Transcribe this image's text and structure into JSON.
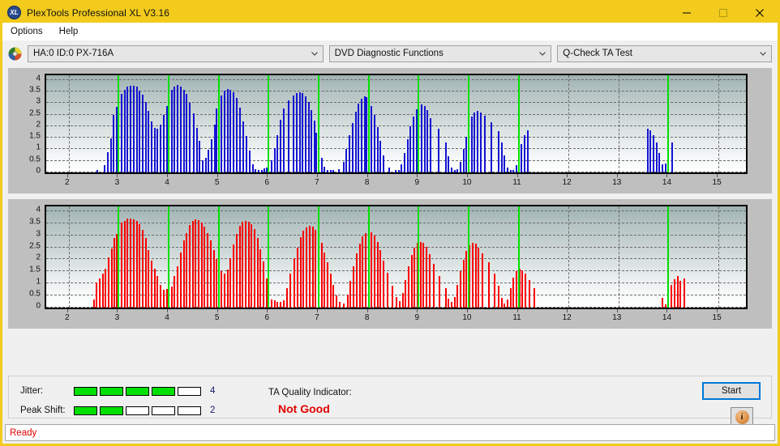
{
  "window": {
    "title": "PlexTools Professional XL V3.16",
    "app_icon": "xl-disc-icon",
    "minimize_label": "Minimize",
    "maximize_label": "Maximize",
    "close_label": "Close",
    "titlebar_color": "#f2cb1d"
  },
  "menubar": {
    "items": [
      {
        "label": "Options"
      },
      {
        "label": "Help"
      }
    ]
  },
  "selectors": {
    "drive_icon": "disc-icon",
    "drive": {
      "value": "HA:0 ID:0  PX-716A",
      "label": "Drive selector"
    },
    "function": {
      "value": "DVD Diagnostic Functions",
      "label": "Function selector"
    },
    "test": {
      "value": "Q-Check TA Test",
      "label": "Test selector"
    }
  },
  "chart_data": [
    {
      "id": "top-chart",
      "type": "bar",
      "title": "",
      "series_name": "Jitter",
      "color": "#1414d2",
      "xlabel": "",
      "ylabel": "",
      "ylim": [
        0,
        4.2
      ],
      "yticks": [
        0,
        0.5,
        1,
        1.5,
        2,
        2.5,
        3,
        3.5,
        4
      ],
      "ytick_labels": [
        "0",
        "0.5",
        "1",
        "1.5",
        "2",
        "2.5",
        "3",
        "3.5",
        "4"
      ],
      "xlim": [
        1.55,
        15.55
      ],
      "xticks": [
        2,
        3,
        4,
        5,
        6,
        7,
        8,
        9,
        10,
        11,
        12,
        13,
        14,
        15
      ],
      "xtick_labels": [
        "2",
        "3",
        "4",
        "5",
        "6",
        "7",
        "8",
        "9",
        "10",
        "11",
        "12",
        "13",
        "14",
        "15"
      ],
      "grid": true,
      "markers": [
        3,
        4,
        5,
        6,
        7,
        8,
        9,
        10,
        11,
        14
      ],
      "marker_color": "#00e000",
      "x": [
        2.58,
        2.72,
        2.78,
        2.84,
        2.9,
        2.96,
        3.0,
        3.06,
        3.12,
        3.18,
        3.24,
        3.3,
        3.36,
        3.42,
        3.48,
        3.54,
        3.6,
        3.66,
        3.72,
        3.78,
        3.84,
        3.9,
        3.96,
        4.0,
        4.06,
        4.12,
        4.18,
        4.24,
        4.3,
        4.36,
        4.42,
        4.5,
        4.56,
        4.62,
        4.68,
        4.74,
        4.8,
        4.86,
        4.92,
        4.96,
        5.0,
        5.06,
        5.12,
        5.18,
        5.24,
        5.3,
        5.36,
        5.42,
        5.5,
        5.56,
        5.62,
        5.68,
        5.74,
        5.8,
        5.86,
        5.92,
        5.96,
        6.0,
        6.06,
        6.12,
        6.18,
        6.24,
        6.3,
        6.4,
        6.5,
        6.56,
        6.62,
        6.68,
        6.74,
        6.8,
        6.86,
        6.92,
        6.96,
        7.0,
        7.06,
        7.12,
        7.18,
        7.24,
        7.3,
        7.4,
        7.5,
        7.56,
        7.62,
        7.68,
        7.74,
        7.8,
        7.86,
        7.92,
        7.96,
        8.0,
        8.06,
        8.12,
        8.18,
        8.24,
        8.3,
        8.42,
        8.54,
        8.6,
        8.66,
        8.72,
        8.78,
        8.84,
        8.9,
        8.96,
        9.0,
        9.06,
        9.12,
        9.18,
        9.24,
        9.4,
        9.54,
        9.6,
        9.66,
        9.72,
        9.78,
        9.84,
        9.9,
        9.96,
        10.0,
        10.06,
        10.12,
        10.18,
        10.24,
        10.32,
        10.46,
        10.6,
        10.66,
        10.72,
        10.78,
        10.84,
        10.9,
        10.96,
        11.0,
        11.06,
        11.12,
        11.18,
        13.58,
        13.64,
        13.7,
        13.76,
        13.82,
        13.88,
        13.94,
        14.0,
        14.08
      ],
      "values": [
        0.1,
        0.33,
        0.88,
        1.46,
        2.5,
        2.83,
        3.13,
        3.4,
        3.58,
        3.7,
        3.76,
        3.75,
        3.7,
        3.55,
        3.35,
        3.05,
        2.67,
        2.22,
        1.92,
        1.9,
        2.08,
        2.5,
        2.88,
        3.25,
        3.56,
        3.72,
        3.78,
        3.7,
        3.58,
        3.38,
        3.02,
        2.56,
        1.92,
        1.35,
        0.52,
        0.63,
        0.98,
        1.45,
        2.08,
        2.75,
        3.07,
        3.33,
        3.52,
        3.6,
        3.58,
        3.45,
        3.22,
        2.8,
        2.2,
        1.56,
        0.95,
        0.35,
        0.15,
        0.1,
        0.12,
        0.16,
        0.2,
        0.24,
        0.52,
        1.05,
        1.62,
        2.28,
        2.75,
        3.1,
        3.32,
        3.44,
        3.46,
        3.42,
        3.28,
        3.05,
        2.7,
        2.25,
        1.72,
        1.15,
        0.62,
        0.25,
        0.12,
        0.1,
        0.1,
        0.15,
        0.45,
        1.0,
        1.6,
        2.15,
        2.62,
        2.98,
        3.2,
        3.28,
        3.25,
        3.12,
        2.86,
        2.48,
        1.95,
        1.35,
        0.72,
        0.22,
        0.1,
        0.12,
        0.35,
        0.85,
        1.45,
        2.0,
        2.42,
        2.72,
        2.9,
        2.95,
        2.88,
        2.68,
        2.35,
        1.88,
        1.3,
        0.7,
        0.2,
        0.1,
        0.15,
        0.45,
        1.0,
        1.55,
        2.05,
        2.42,
        2.6,
        2.65,
        2.6,
        2.45,
        2.18,
        1.78,
        1.28,
        0.72,
        0.22,
        0.1,
        0.12,
        0.3,
        0.72,
        1.22,
        1.6,
        1.82,
        1.88,
        1.82,
        1.62,
        1.28,
        0.85,
        0.35,
        0.4,
        0.78,
        1.3,
        1.8,
        2.08,
        2.18,
        2.14,
        1.95,
        0.18
      ]
    },
    {
      "id": "bottom-chart",
      "type": "bar",
      "title": "",
      "series_name": "Peak Shift",
      "color": "#fa0000",
      "xlabel": "",
      "ylabel": "",
      "ylim": [
        0,
        4.2
      ],
      "yticks": [
        0,
        0.5,
        1,
        1.5,
        2,
        2.5,
        3,
        3.5,
        4
      ],
      "ytick_labels": [
        "0",
        "0.5",
        "1",
        "1.5",
        "2",
        "2.5",
        "3",
        "3.5",
        "4"
      ],
      "xlim": [
        1.55,
        15.55
      ],
      "xticks": [
        2,
        3,
        4,
        5,
        6,
        7,
        8,
        9,
        10,
        11,
        12,
        13,
        14,
        15
      ],
      "xtick_labels": [
        "2",
        "3",
        "4",
        "5",
        "6",
        "7",
        "8",
        "9",
        "10",
        "11",
        "12",
        "13",
        "14",
        "15"
      ],
      "grid": true,
      "markers": [
        3,
        4,
        5,
        6,
        7,
        8,
        9,
        10,
        11,
        14
      ],
      "marker_color": "#00e000",
      "x": [
        2.5,
        2.56,
        2.62,
        2.68,
        2.74,
        2.8,
        2.86,
        2.92,
        2.96,
        3.0,
        3.06,
        3.12,
        3.18,
        3.24,
        3.3,
        3.36,
        3.42,
        3.48,
        3.54,
        3.6,
        3.66,
        3.72,
        3.78,
        3.84,
        3.9,
        3.96,
        4.0,
        4.06,
        4.12,
        4.18,
        4.24,
        4.3,
        4.36,
        4.42,
        4.48,
        4.54,
        4.6,
        4.66,
        4.72,
        4.78,
        4.84,
        4.9,
        4.96,
        5.0,
        5.06,
        5.12,
        5.18,
        5.24,
        5.3,
        5.36,
        5.42,
        5.48,
        5.54,
        5.6,
        5.66,
        5.72,
        5.78,
        5.84,
        5.9,
        5.96,
        6.0,
        6.06,
        6.12,
        6.18,
        6.24,
        6.3,
        6.36,
        6.44,
        6.52,
        6.58,
        6.64,
        6.7,
        6.76,
        6.82,
        6.88,
        6.94,
        7.0,
        7.06,
        7.12,
        7.18,
        7.24,
        7.3,
        7.36,
        7.42,
        7.5,
        7.58,
        7.64,
        7.7,
        7.76,
        7.82,
        7.88,
        7.94,
        8.0,
        8.06,
        8.12,
        8.18,
        8.24,
        8.3,
        8.38,
        8.48,
        8.56,
        8.62,
        8.68,
        8.74,
        8.8,
        8.86,
        8.92,
        8.98,
        9.04,
        9.1,
        9.16,
        9.22,
        9.3,
        9.42,
        9.54,
        9.6,
        9.66,
        9.72,
        9.78,
        9.84,
        9.9,
        9.96,
        10.02,
        10.08,
        10.14,
        10.2,
        10.28,
        10.4,
        10.52,
        10.6,
        10.66,
        10.72,
        10.78,
        10.84,
        10.9,
        10.96,
        11.02,
        11.08,
        11.14,
        11.22,
        11.32,
        13.88,
        13.94,
        14.0,
        14.06,
        14.12,
        14.18,
        14.24,
        14.32
      ],
      "values": [
        0.33,
        1.05,
        1.22,
        1.42,
        1.6,
        2.1,
        2.45,
        2.9,
        3.05,
        3.4,
        3.52,
        3.6,
        3.68,
        3.7,
        3.66,
        3.58,
        3.45,
        3.22,
        2.88,
        2.4,
        1.95,
        1.6,
        1.3,
        0.95,
        0.74,
        0.78,
        0.8,
        0.88,
        1.3,
        1.72,
        2.3,
        2.78,
        3.1,
        3.42,
        3.6,
        3.66,
        3.62,
        3.52,
        3.35,
        3.1,
        2.78,
        2.4,
        2.02,
        1.72,
        1.5,
        1.42,
        1.58,
        2.05,
        2.62,
        3.05,
        3.38,
        3.55,
        3.58,
        3.55,
        3.45,
        3.25,
        2.9,
        2.42,
        1.9,
        1.2,
        0.55,
        0.35,
        0.3,
        0.25,
        0.22,
        0.3,
        0.8,
        1.4,
        2.05,
        2.5,
        2.92,
        3.18,
        3.32,
        3.38,
        3.35,
        3.22,
        3.0,
        2.68,
        2.3,
        1.88,
        1.42,
        0.95,
        0.5,
        0.22,
        0.18,
        0.55,
        1.1,
        1.72,
        2.25,
        2.65,
        2.95,
        3.1,
        3.18,
        3.12,
        2.98,
        2.72,
        2.38,
        1.95,
        1.45,
        0.92,
        0.45,
        0.28,
        0.6,
        1.15,
        1.7,
        2.18,
        2.5,
        2.68,
        2.72,
        2.68,
        2.52,
        2.22,
        1.82,
        1.32,
        0.82,
        0.38,
        0.22,
        0.45,
        0.95,
        1.5,
        1.98,
        2.35,
        2.58,
        2.68,
        2.65,
        2.5,
        2.25,
        1.88,
        1.42,
        0.92,
        0.42,
        0.18,
        0.35,
        0.82,
        1.25,
        1.52,
        1.6,
        1.55,
        1.4,
        1.15,
        0.82,
        0.42,
        0.15,
        0.1,
        0.95,
        1.18,
        1.3,
        1.12,
        1.2,
        0.32,
        0.28,
        0.18
      ]
    }
  ],
  "metrics": {
    "jitter": {
      "label": "Jitter:",
      "value": "4",
      "filled": 4,
      "total": 5,
      "on_color": "#00e000"
    },
    "peak_shift": {
      "label": "Peak Shift:",
      "value": "2",
      "filled": 2,
      "total": 5,
      "on_color": "#00e000"
    }
  },
  "quality": {
    "label": "TA Quality Indicator:",
    "value": "Not Good",
    "value_color": "#e00000"
  },
  "actions": {
    "start_label": "Start",
    "info_label": "i",
    "info_icon": "info-icon"
  },
  "statusbar": {
    "text": "Ready",
    "text_color": "#e00000"
  }
}
